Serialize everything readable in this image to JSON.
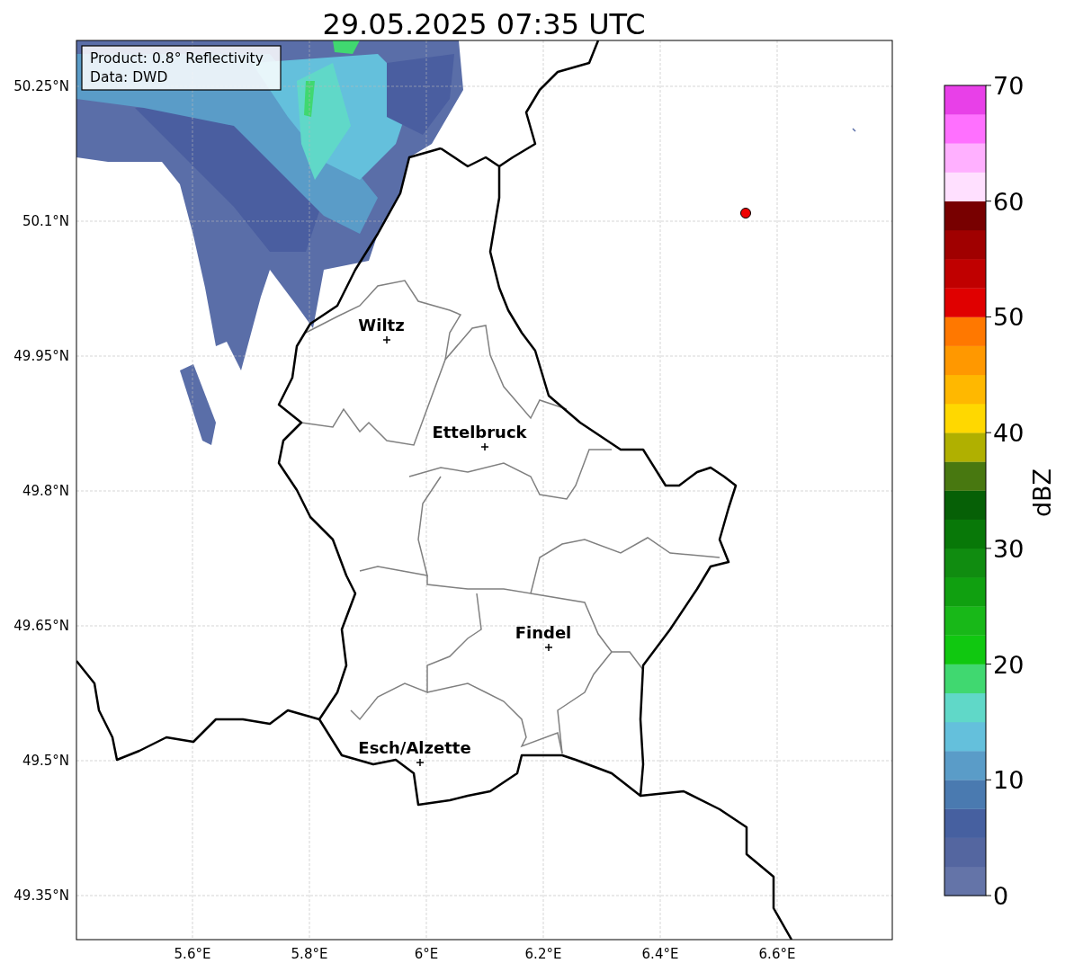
{
  "title": "29.05.2025 07:35 UTC",
  "info_box": [
    "Product: 0.8° Reflectivity",
    "Data: DWD"
  ],
  "map": {
    "lat_ticks": [
      "50.25°N",
      "50.1°N",
      "49.95°N",
      "49.8°N",
      "49.65°N",
      "49.5°N",
      "49.35°N"
    ],
    "lon_ticks": [
      "5.6°E",
      "5.8°E",
      "6°E",
      "6.2°E",
      "6.4°E",
      "6.6°E"
    ],
    "cities": [
      {
        "name": "Wiltz"
      },
      {
        "name": "Ettelbruck"
      },
      {
        "name": "Findel"
      },
      {
        "name": "Esch/Alzette"
      }
    ]
  },
  "colorbar": {
    "label": "dBZ",
    "ticks": [
      "70",
      "60",
      "50",
      "40",
      "30",
      "20",
      "10",
      "0"
    ],
    "bins": [
      {
        "color": "#6474a8"
      },
      {
        "color": "#5466a0"
      },
      {
        "color": "#4660a0"
      },
      {
        "color": "#4a7ab0"
      },
      {
        "color": "#5a9cc8"
      },
      {
        "color": "#64c0dc"
      },
      {
        "color": "#60d8c8"
      },
      {
        "color": "#40d870"
      },
      {
        "color": "#10c810"
      },
      {
        "color": "#18b818"
      },
      {
        "color": "#10a010"
      },
      {
        "color": "#108c10"
      },
      {
        "color": "#087808"
      },
      {
        "color": "#066006"
      },
      {
        "color": "#487810"
      },
      {
        "color": "#b0b000"
      },
      {
        "color": "#ffd800"
      },
      {
        "color": "#ffb800"
      },
      {
        "color": "#ff9800"
      },
      {
        "color": "#ff7800"
      },
      {
        "color": "#e00000"
      },
      {
        "color": "#c00000"
      },
      {
        "color": "#a00000"
      },
      {
        "color": "#780000"
      },
      {
        "color": "#ffe0ff"
      },
      {
        "color": "#ffb0ff"
      },
      {
        "color": "#ff70ff"
      },
      {
        "color": "#e840e8"
      }
    ]
  }
}
